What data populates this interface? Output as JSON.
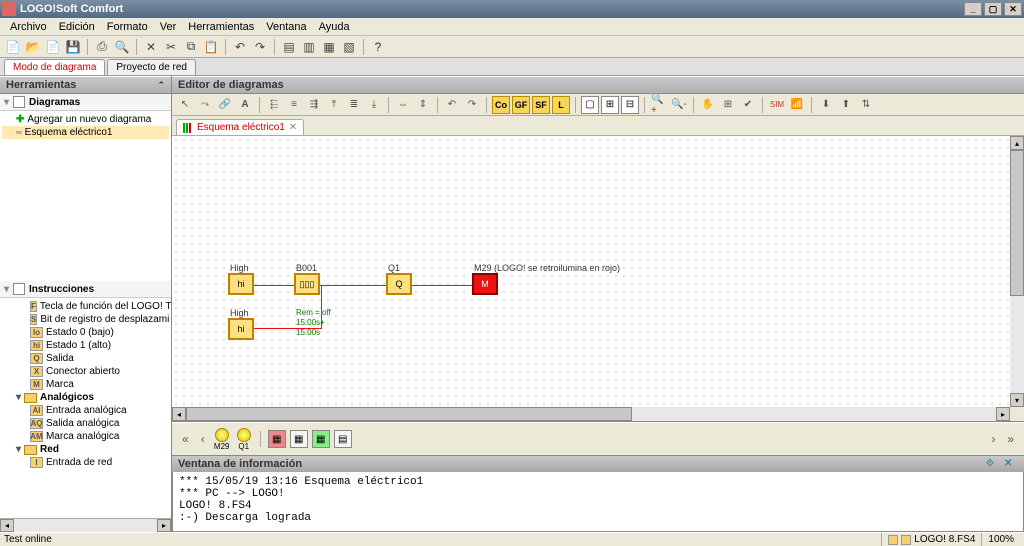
{
  "app": {
    "title": "LOGO!Soft Comfort"
  },
  "menus": [
    "Archivo",
    "Edición",
    "Formato",
    "Ver",
    "Herramientas",
    "Ventana",
    "Ayuda"
  ],
  "mode_tabs": {
    "active": "Modo de diagrama",
    "other": "Proyecto de red"
  },
  "left": {
    "tools_hdr": "Herramientas",
    "diagrams_hdr": "Diagramas",
    "add_new": "Agregar un nuevo diagrama",
    "diagram1": "Esquema eléctrico1",
    "instr_hdr": "Instrucciones",
    "instr_items": [
      {
        "badge": "F",
        "label": "Tecla de función del LOGO! T"
      },
      {
        "badge": "S",
        "label": "Bit de registro de desplazami"
      },
      {
        "badge": "lo",
        "label": "Estado 0 (bajo)"
      },
      {
        "badge": "hi",
        "label": "Estado 1 (alto)"
      },
      {
        "badge": "Q",
        "label": "Salida"
      },
      {
        "badge": "X",
        "label": "Conector abierto"
      },
      {
        "badge": "M",
        "label": "Marca"
      }
    ],
    "grp_analog": "Analógicos",
    "analog_items": [
      {
        "badge": "AI",
        "label": "Entrada analógica"
      },
      {
        "badge": "AQ",
        "label": "Salida analógica"
      },
      {
        "badge": "AM",
        "label": "Marca analógica"
      }
    ],
    "grp_red": "Red",
    "red_items": [
      {
        "badge": "I",
        "label": "Entrada de red"
      }
    ]
  },
  "editor": {
    "hdr": "Editor de diagramas",
    "tab": "Esquema eléctrico1",
    "blocks": {
      "hi1": {
        "label": "High",
        "txt": "hi"
      },
      "hi2": {
        "label": "High",
        "txt": "hi"
      },
      "b001": {
        "label": "B001",
        "txt": "▯▯▯",
        "params": [
          "Rem = off",
          "15:00s+",
          "15:00s"
        ]
      },
      "q1": {
        "label": "Q1",
        "txt": "Q"
      },
      "m29": {
        "label": "M29 (LOGO! se retroilumina en rojo)",
        "txt": "M"
      }
    }
  },
  "sim": {
    "m29": "M29",
    "q1": "Q1"
  },
  "info": {
    "hdr": "Ventana de información",
    "lines": [
      "*** 15/05/19 13:16 Esquema eléctrico1",
      "*** PC --> LOGO!",
      "LOGO! 8.FS4",
      ":-) Descarga lograda"
    ]
  },
  "status": {
    "left": "Test online",
    "device": "LOGO! 8.FS4",
    "zoom": "100%"
  }
}
